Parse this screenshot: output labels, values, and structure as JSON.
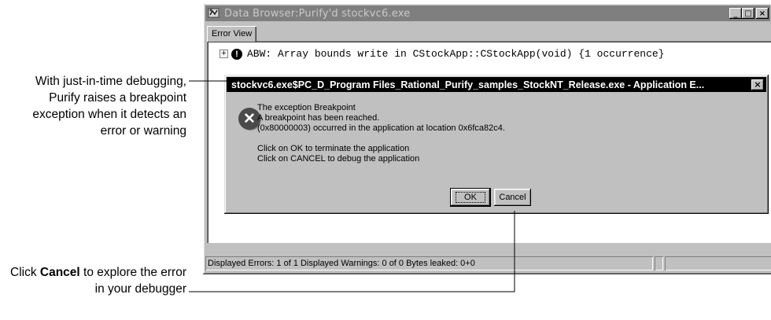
{
  "window": {
    "title": "Data Browser:Purify'd stockvc6.exe",
    "minimize": "_",
    "maximize": "□",
    "close": "×"
  },
  "tabs": [
    {
      "label": "Error View"
    }
  ],
  "error_tree": {
    "expander": "+",
    "icon_glyph": "!",
    "entry": "ABW: Array bounds write in CStockApp::CStockApp(void) {1 occurrence}"
  },
  "dialog": {
    "title": "stockvc6.exe$PC_D_Program Files_Rational_Purify_samples_StockNT_Release.exe - Application E...",
    "close": "×",
    "icon_glyph": "✕",
    "lines": [
      "The exception Breakpoint",
      "A breakpoint has been reached.",
      "(0x80000003) occurred in the application at location 0x6fca82c4.",
      "Click on OK to terminate the application",
      "Click on CANCEL to debug the application"
    ],
    "ok_label": "OK",
    "cancel_label": "Cancel"
  },
  "status_bar": {
    "text": "Displayed Errors: 1 of 1     Displayed Warnings: 0 of 0     Bytes leaked: 0+0"
  },
  "callouts": {
    "top": "With just-in-time debugging, Purify raises a breakpoint exception when it detects an error or warning",
    "bottom_prefix": "Click ",
    "bottom_bold": "Cancel",
    "bottom_suffix": " to explore the error in your debugger"
  }
}
